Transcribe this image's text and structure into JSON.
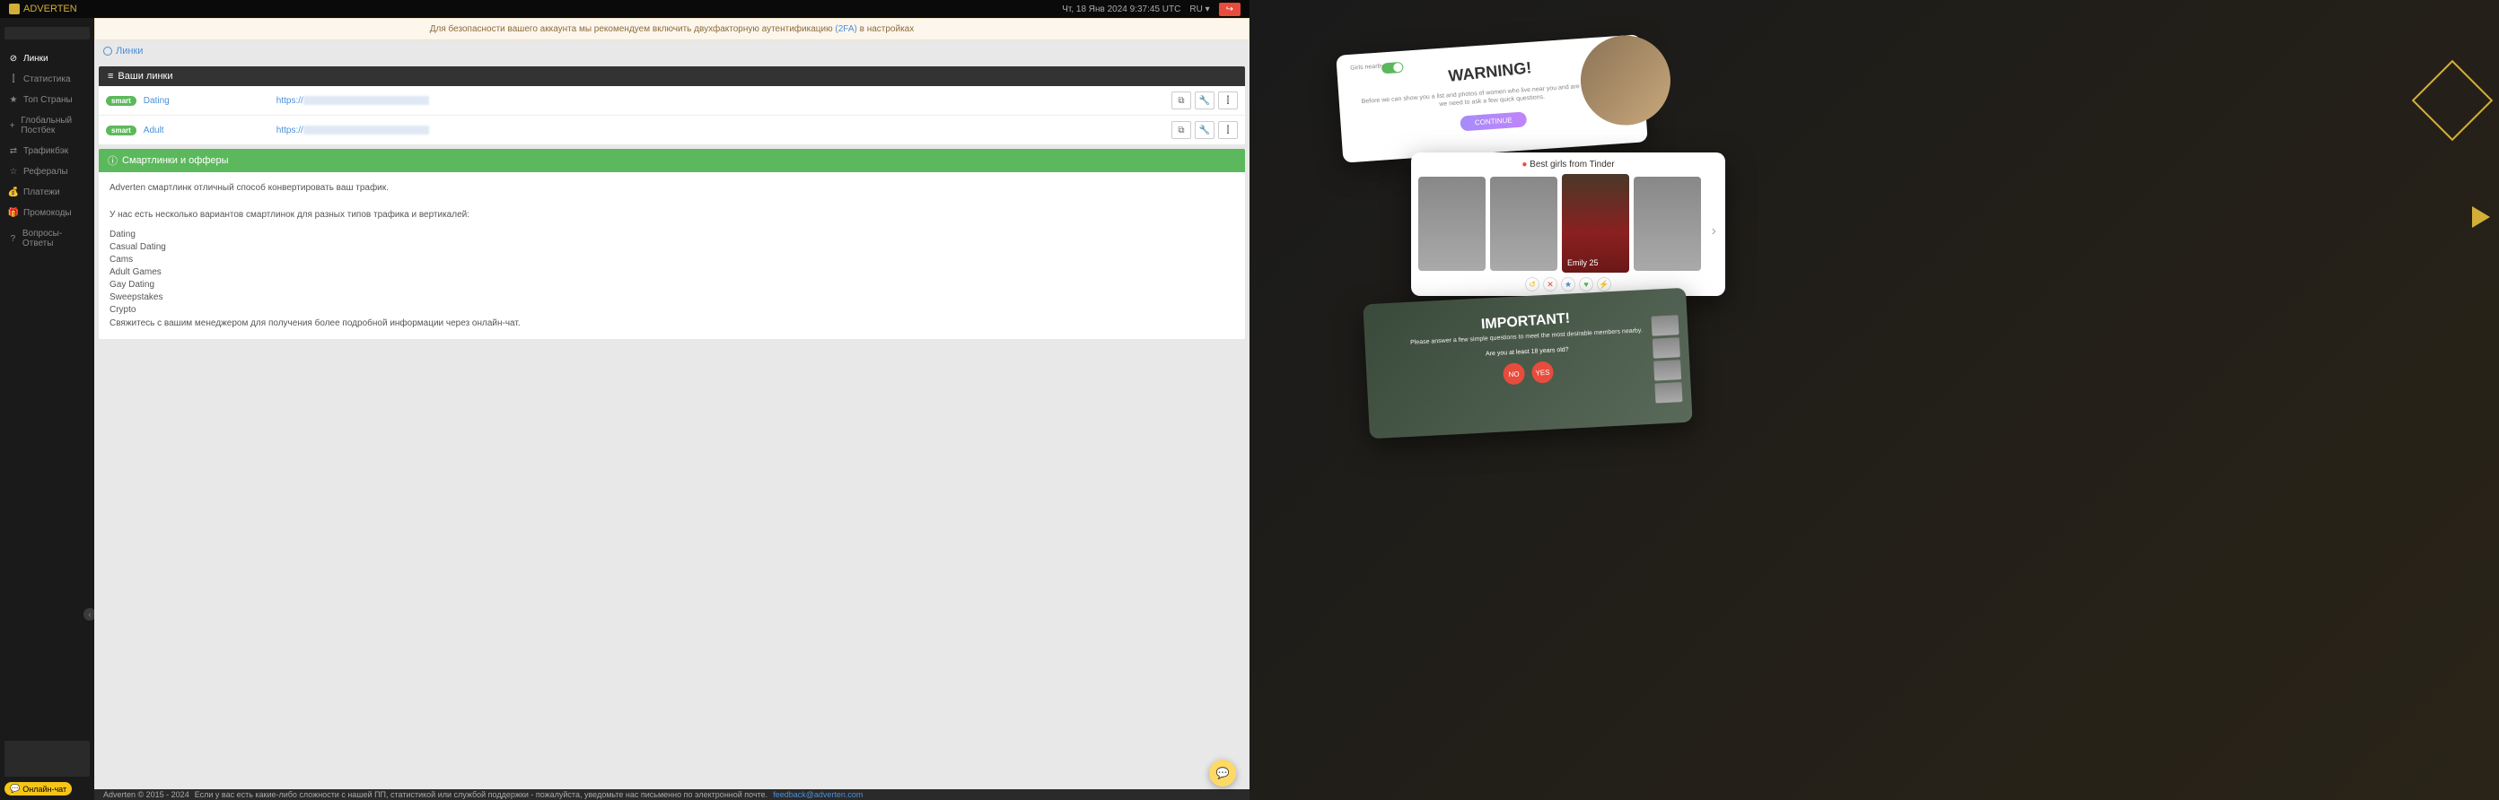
{
  "header": {
    "logo_text": "ADVERTEN",
    "datetime": "Чт, 18 Янв 2024 9:37:45 UTC",
    "lang": "RU"
  },
  "sidebar": {
    "items": [
      {
        "label": "Линки",
        "icon": "⊘"
      },
      {
        "label": "Статистика",
        "icon": "⫿"
      },
      {
        "label": "Топ Страны",
        "icon": "★"
      },
      {
        "label": "Глобальный Постбек",
        "icon": "+"
      },
      {
        "label": "Трафикбэк",
        "icon": "⇄"
      },
      {
        "label": "Рефералы",
        "icon": "☆"
      },
      {
        "label": "Платежи",
        "icon": "💰"
      },
      {
        "label": "Промокоды",
        "icon": "🎁"
      },
      {
        "label": "Вопросы-Ответы",
        "icon": "?"
      }
    ],
    "chat_label": "Онлайн-чат"
  },
  "alert": {
    "text": "Для безопасности вашего аккаунта мы рекомендуем включить двухфакторную аутентификацию",
    "link": "(2FA)",
    "suffix": "в настройках"
  },
  "breadcrumb": {
    "label": "Линки"
  },
  "links_panel": {
    "title": "Ваши линки",
    "badge": "smart",
    "rows": [
      {
        "name": "Dating",
        "url_prefix": "https://"
      },
      {
        "name": "Adult",
        "url_prefix": "https://"
      }
    ]
  },
  "offers_panel": {
    "title": "Смартлинки и офферы",
    "intro": "Adverten смартлинк отличный способ конвертировать ваш трафик.",
    "subtitle": "У нас есть несколько вариантов смартлинок для разных типов трафика и вертикалей:",
    "verticals": [
      "Dating",
      "Casual Dating",
      "Cams",
      "Adult Games",
      "Gay Dating",
      "Sweepstakes",
      "Crypto"
    ],
    "contact": "Свяжитесь с вашим менеджером для получения более подробной информации через онлайн-чат."
  },
  "footer": {
    "copyright": "Adverten © 2015 - 2024",
    "text": "Если у вас есть какие-либо сложности с нашей ПП, статистикой или службой поддержки - пожалуйста, уведомьте нас письменно по электронной почте.",
    "email": "feedback@adverten.com"
  },
  "previews": {
    "card1": {
      "toggle_label": "Girls nearby",
      "title": "WARNING!",
      "desc": "Before we can show you a list and photos of women who live near you and are ready to meet, we need to ask a few quick questions.",
      "button": "CONTINUE"
    },
    "card2": {
      "title": "Best girls from Tinder",
      "profile_name": "Emily",
      "profile_age": "25"
    },
    "card3": {
      "title": "IMPORTANT!",
      "desc": "Please answer a few simple questions to meet the most desirable members nearby.",
      "question": "Are you at least 18 years old?",
      "no": "NO",
      "yes": "YES"
    }
  }
}
